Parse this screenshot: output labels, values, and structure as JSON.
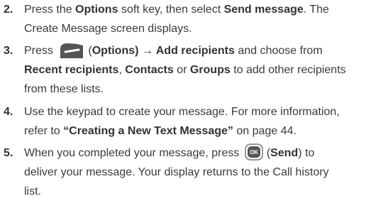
{
  "colors": {
    "text": "#3a3a3a",
    "key_fill": "#555555"
  },
  "steps": [
    {
      "number": "2.",
      "lines": [
        {
          "a": "Press the ",
          "b": "Options",
          "c": " soft key, then select ",
          "d": "Send message",
          "e": ". The"
        },
        {
          "a": "Create Message screen displays."
        }
      ]
    },
    {
      "number": "3.",
      "icon": "left-soft-key-icon",
      "lines": [
        {
          "a": "Press",
          "b": "(",
          "c": "Options",
          "d": ") → ",
          "e": "Add recipients",
          "f": " and choose from"
        },
        {
          "a": "Recent recipients",
          "b": ", ",
          "c": "Contacts",
          "d": " or ",
          "e": "Groups",
          "f": " to add other recipients"
        },
        {
          "a": "from these lists."
        }
      ]
    },
    {
      "number": "4.",
      "lines": [
        {
          "a": "Use the keypad to create your message. For more information,"
        },
        {
          "a": "refer to ",
          "b": "“Creating a New Text Message”",
          "c": "  on page 44."
        }
      ]
    },
    {
      "number": "5.",
      "icon": "ok-key-icon",
      "icon_label": "OK",
      "lines": [
        {
          "a": "When you completed your message, press",
          "b": "(",
          "c": "Send",
          "d": ") to"
        },
        {
          "a": "deliver your message. Your display returns to the Call history"
        },
        {
          "a": "list."
        }
      ]
    }
  ]
}
